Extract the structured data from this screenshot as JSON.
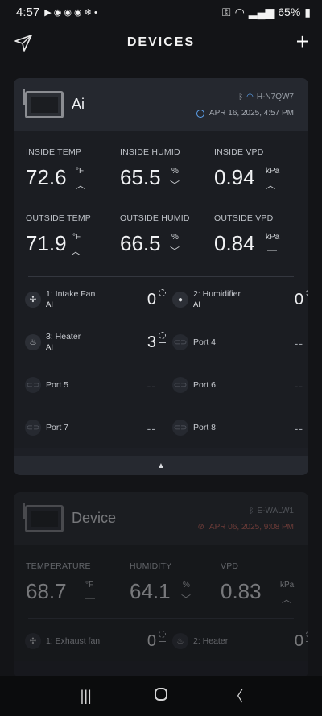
{
  "status_bar": {
    "time": "4:57",
    "icons": [
      "youtube-icon",
      "app-icon",
      "app-icon",
      "app-icon",
      "snowflake-icon",
      "dot"
    ],
    "battery": "65%"
  },
  "header": {
    "title": "DEVICES",
    "add_label": "+"
  },
  "devices": [
    {
      "name": "Ai",
      "network_id": "H-N7QW7",
      "timestamp": "APR 16, 2025, 4:57 PM",
      "metrics": [
        {
          "label": "INSIDE TEMP",
          "value": "72.6",
          "unit": "°F",
          "trend": "up"
        },
        {
          "label": "INSIDE HUMID",
          "value": "65.5",
          "unit": "%",
          "trend": "down"
        },
        {
          "label": "INSIDE VPD",
          "value": "0.94",
          "unit": "kPa",
          "trend": "up"
        },
        {
          "label": "OUTSIDE TEMP",
          "value": "71.9",
          "unit": "°F",
          "trend": "up"
        },
        {
          "label": "OUTSIDE HUMID",
          "value": "66.5",
          "unit": "%",
          "trend": "down"
        },
        {
          "label": "OUTSIDE VPD",
          "value": "0.84",
          "unit": "kPa",
          "trend": "flat"
        }
      ],
      "ports": [
        {
          "name": "1: Intake Fan",
          "mode": "AI",
          "level": "0",
          "icon": "fan-icon"
        },
        {
          "name": "2: Humidifier",
          "mode": "AI",
          "level": "0",
          "icon": "drop-icon"
        },
        {
          "name": "3: Heater",
          "mode": "AI",
          "level": "3",
          "icon": "flame-icon"
        },
        {
          "name": "Port 4",
          "mode": "",
          "level": "--",
          "icon": "plug-icon"
        },
        {
          "name": "Port 5",
          "mode": "",
          "level": "--",
          "icon": "plug-icon"
        },
        {
          "name": "Port 6",
          "mode": "",
          "level": "--",
          "icon": "plug-icon"
        },
        {
          "name": "Port 7",
          "mode": "",
          "level": "--",
          "icon": "plug-icon"
        },
        {
          "name": "Port 8",
          "mode": "",
          "level": "--",
          "icon": "plug-icon"
        }
      ]
    },
    {
      "name": "Device",
      "network_id": "E-WALW1",
      "timestamp": "APR 06, 2025, 9:08 PM",
      "metrics": [
        {
          "label": "TEMPERATURE",
          "value": "68.7",
          "unit": "°F",
          "trend": "flat"
        },
        {
          "label": "HUMIDITY",
          "value": "64.1",
          "unit": "%",
          "trend": "down"
        },
        {
          "label": "VPD",
          "value": "0.83",
          "unit": "kPa",
          "trend": "up"
        }
      ],
      "ports": [
        {
          "name": "1: Exhaust fan",
          "mode": "",
          "level": "0",
          "icon": "fan-icon"
        },
        {
          "name": "2: Heater",
          "mode": "",
          "level": "0",
          "icon": "flame-icon"
        }
      ]
    }
  ],
  "colors": {
    "background": "#131417",
    "card": "#1d1f25",
    "accent": "#5da3ef",
    "offline": "#d86b5f"
  }
}
